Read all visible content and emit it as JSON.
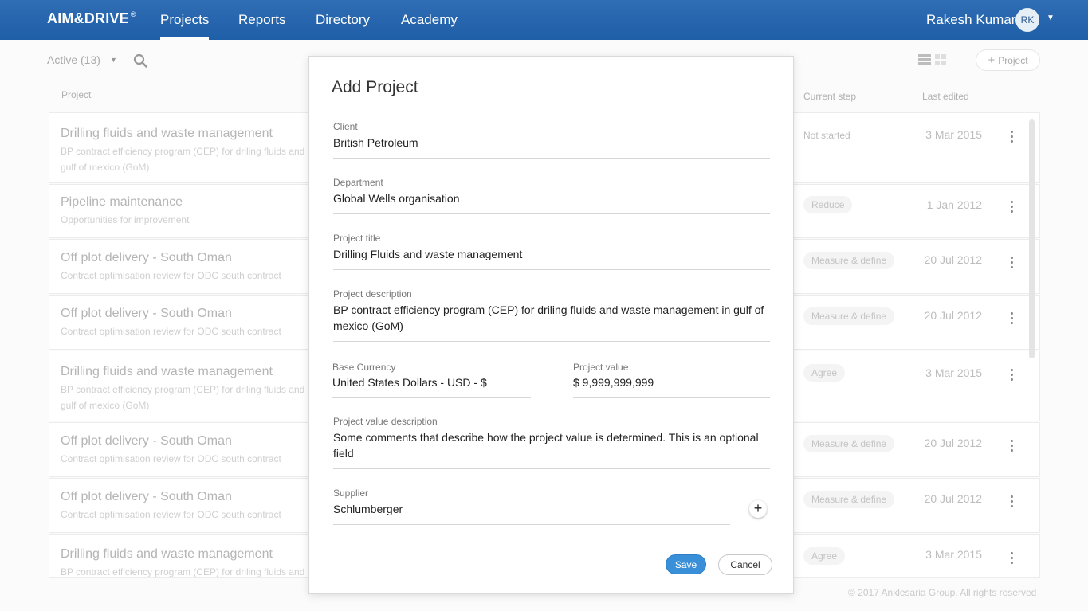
{
  "header": {
    "brand": "AIM&DRIVE",
    "brand_mark": "®",
    "nav": [
      {
        "label": "Projects",
        "active": true
      },
      {
        "label": "Reports",
        "active": false
      },
      {
        "label": "Directory",
        "active": false
      },
      {
        "label": "Academy",
        "active": false
      }
    ],
    "user_name": "Rakesh Kumar",
    "user_initials": "RK",
    "user_caret": "▼"
  },
  "toolbar": {
    "filter_label": "Active (13)",
    "filter_caret": "▼",
    "add_project_label": "Project",
    "add_project_plus": "+"
  },
  "table": {
    "columns": {
      "project": "Project",
      "current_step": "Current step",
      "last_edited": "Last edited"
    },
    "rows": [
      {
        "title": "Drilling fluids and waste management",
        "desc": "BP contract efficiency program (CEP) for driling fluids and in gulf of mexico (GoM)",
        "step": "Not started",
        "date": "3 Mar 2015"
      },
      {
        "title": "Pipeline maintenance",
        "desc": "Opportunities for improvement",
        "step": "Reduce",
        "date": "1 Jan 2012"
      },
      {
        "title": "Off plot delivery - South Oman",
        "desc": "Contract optimisation review for ODC south contract",
        "step": "Measure & define",
        "date": "20 Jul 2012"
      },
      {
        "title": "Off plot delivery - South Oman",
        "desc": "Contract optimisation review for ODC south contract",
        "step": "Measure & define",
        "date": "20 Jul 2012"
      },
      {
        "title": "Drilling fluids and waste management",
        "desc": "BP contract efficiency program (CEP) for driling fluids and in gulf of mexico (GoM)",
        "step": "Agree",
        "date": "3 Mar 2015"
      },
      {
        "title": "Off plot delivery - South Oman",
        "desc": "Contract optimisation review for ODC south contract",
        "step": "Measure & define",
        "date": "20 Jul 2012"
      },
      {
        "title": "Off plot delivery - South Oman",
        "desc": "Contract optimisation review for ODC south contract",
        "step": "Measure & define",
        "date": "20 Jul 2012"
      },
      {
        "title": "Drilling fluids and waste management",
        "desc": "BP contract efficiency program (CEP) for driling fluids and",
        "step": "Agree",
        "date": "3 Mar 2015"
      }
    ]
  },
  "footer": "© 2017 Anklesaria Group. All rights reserved",
  "modal": {
    "title": "Add Project",
    "client_label": "Client",
    "client_value": "British Petroleum",
    "department_label": "Department",
    "department_value": "Global Wells organisation",
    "project_title_label": "Project title",
    "project_title_value": "Drilling Fluids and waste management",
    "project_description_label": "Project description",
    "project_description_value": "BP contract efficiency program (CEP) for driling fluids and waste management in gulf of mexico (GoM)",
    "base_currency_label": "Base Currency",
    "base_currency_value": "United States Dollars - USD - $",
    "project_value_label": "Project value",
    "project_value_value": "$ 9,999,999,999",
    "project_value_description_label": "Project value description",
    "project_value_description_value": "Some comments that describe how the project value is determined. This is an optional field",
    "supplier_label": "Supplier",
    "supplier_value": "Schlumberger",
    "supplier_add": "+",
    "save_label": "Save",
    "cancel_label": "Cancel"
  }
}
